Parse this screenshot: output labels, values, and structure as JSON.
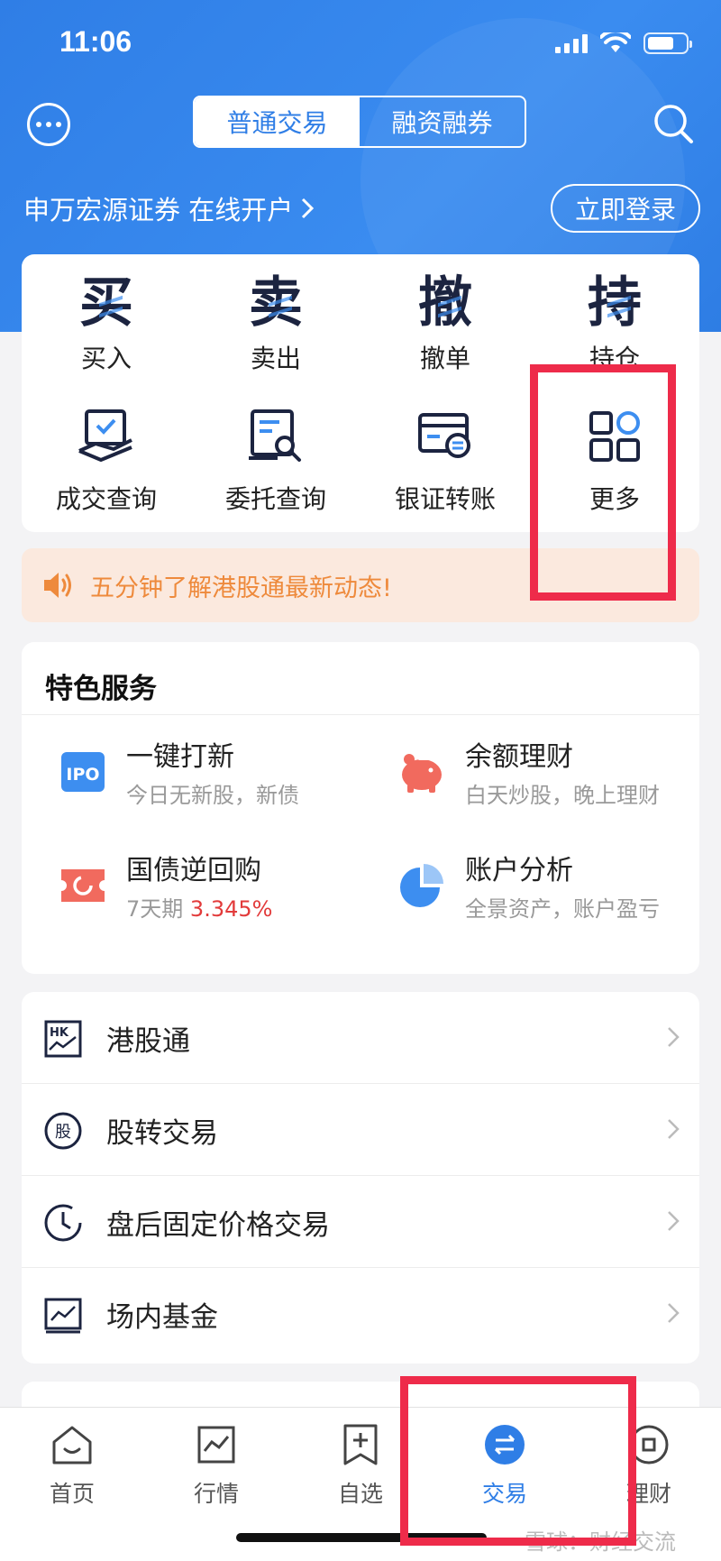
{
  "status_bar": {
    "time": "11:06"
  },
  "header": {
    "segment_tabs": [
      "普通交易",
      "融资融券"
    ],
    "open_account_text": "申万宏源证券 在线开户",
    "login_label": "立即登录"
  },
  "trade_actions": {
    "row1": [
      {
        "char": "买",
        "label": "买入"
      },
      {
        "char": "卖",
        "label": "卖出"
      },
      {
        "char": "撤",
        "label": "撤单"
      },
      {
        "char": "持",
        "label": "持仓"
      }
    ],
    "row2": [
      {
        "icon": "handshake-check-icon",
        "label": "成交查询"
      },
      {
        "icon": "document-search-icon",
        "label": "委托查询"
      },
      {
        "icon": "bank-card-transfer-icon",
        "label": "银证转账"
      },
      {
        "icon": "more-grid-icon",
        "label": "更多"
      }
    ]
  },
  "notice": {
    "text": "五分钟了解港股通最新动态!"
  },
  "services": {
    "title": "特色服务",
    "items": [
      {
        "title": "一键打新",
        "subtitle": "今日无新股，新债",
        "icon": "ipo-icon"
      },
      {
        "title": "余额理财",
        "subtitle": "白天炒股，晚上理财",
        "icon": "piggy-bank-icon"
      },
      {
        "title": "国债逆回购",
        "subtitle_prefix": "7天期",
        "subtitle_value": "3.345%",
        "icon": "ticket-icon"
      },
      {
        "title": "账户分析",
        "subtitle": "全景资产，账户盈亏",
        "icon": "pie-chart-icon"
      }
    ]
  },
  "menu_list": [
    {
      "label": "港股通",
      "icon": "hk-icon"
    },
    {
      "label": "股转交易",
      "icon": "stock-transfer-icon"
    },
    {
      "label": "盘后固定价格交易",
      "icon": "clock-icon"
    },
    {
      "label": "场内基金",
      "icon": "fund-chart-icon"
    }
  ],
  "tabbar": [
    {
      "label": "首页",
      "icon": "home-icon"
    },
    {
      "label": "行情",
      "icon": "market-chart-icon"
    },
    {
      "label": "自选",
      "icon": "watchlist-add-icon"
    },
    {
      "label": "交易",
      "icon": "trade-exchange-icon",
      "active": true
    },
    {
      "label": "理财",
      "icon": "wealth-icon"
    }
  ],
  "watermark": "雪球：财经交流",
  "colors": {
    "brand_blue": "#2f7ee6",
    "highlight_red": "#ee2b4a",
    "notice_orange": "#ee8a3c",
    "rate_red": "#e23b3b"
  }
}
